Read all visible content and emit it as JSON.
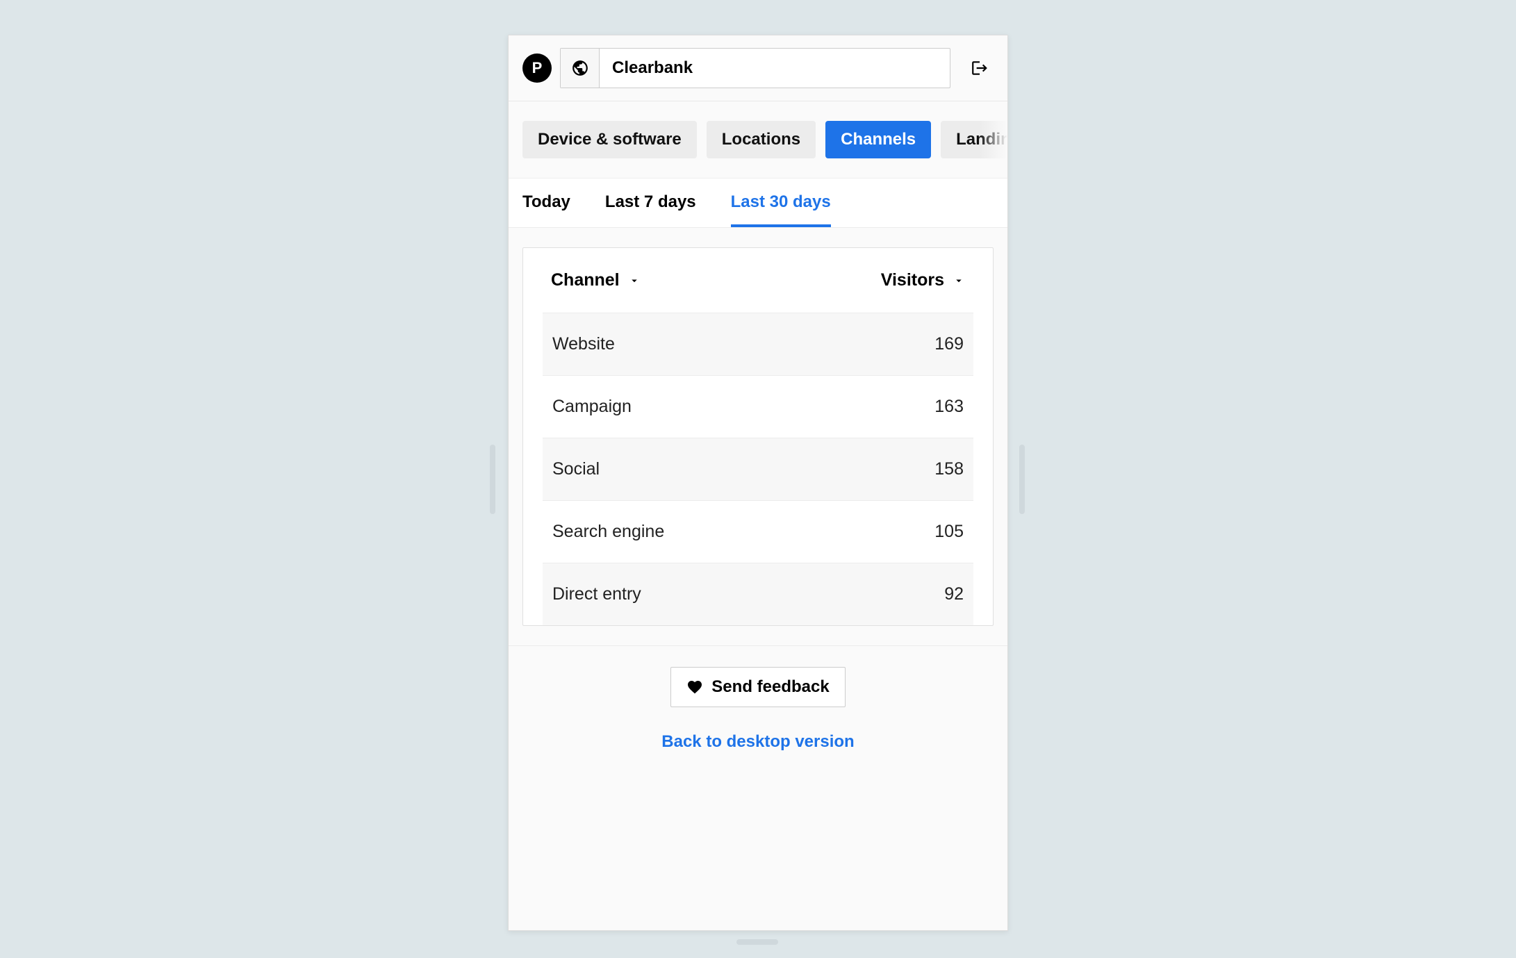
{
  "header": {
    "logo_letter": "P",
    "site_name": "Clearbank"
  },
  "tabs": [
    {
      "label": "Device & software",
      "active": false
    },
    {
      "label": "Locations",
      "active": false
    },
    {
      "label": "Channels",
      "active": true
    },
    {
      "label": "Landing pages",
      "active": false
    }
  ],
  "date_tabs": [
    {
      "label": "Today",
      "active": false
    },
    {
      "label": "Last 7 days",
      "active": false
    },
    {
      "label": "Last 30 days",
      "active": true
    }
  ],
  "table": {
    "col1_header": "Channel",
    "col2_header": "Visitors",
    "rows": [
      {
        "label": "Website",
        "value": "169"
      },
      {
        "label": "Campaign",
        "value": "163"
      },
      {
        "label": "Social",
        "value": "158"
      },
      {
        "label": "Search engine",
        "value": "105"
      },
      {
        "label": "Direct entry",
        "value": "92"
      }
    ]
  },
  "footer": {
    "feedback_label": "Send feedback",
    "desktop_link_label": "Back to desktop version"
  }
}
